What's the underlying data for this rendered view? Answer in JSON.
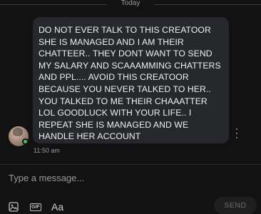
{
  "conversation": {
    "day_label": "Today",
    "message": {
      "text": "DO NOT EVER TALK TO THIS CREATOOR SHE IS MANAGED AND I AM THEIR CHATTEER.. THEY DONT WANT TO SEND MY SALARY AND SCAAAMMING CHATTERS AND PPL.... AVOID THIS CREATOOR BECAUSE YOU NEVER TALKED TO HER.. YOU TALKED TO ME THEIR CHAAATTER LOL GOODLUCK WITH YOUR LIFE.. I REPEAT SHE IS MANAGED AND WE HANDLE HER ACCOUNT",
      "time": "11:50 am",
      "sender_online": true
    }
  },
  "composer": {
    "placeholder": "Type a message...",
    "value": "",
    "tools": {
      "image_icon": "image-icon",
      "gif_label": "GIF",
      "text_format_label": "Aa"
    },
    "send_label": "SEND"
  },
  "colors": {
    "background": "#121212",
    "bubble": "#26282b",
    "online": "#34c759",
    "muted_text": "#9a9a9a"
  }
}
